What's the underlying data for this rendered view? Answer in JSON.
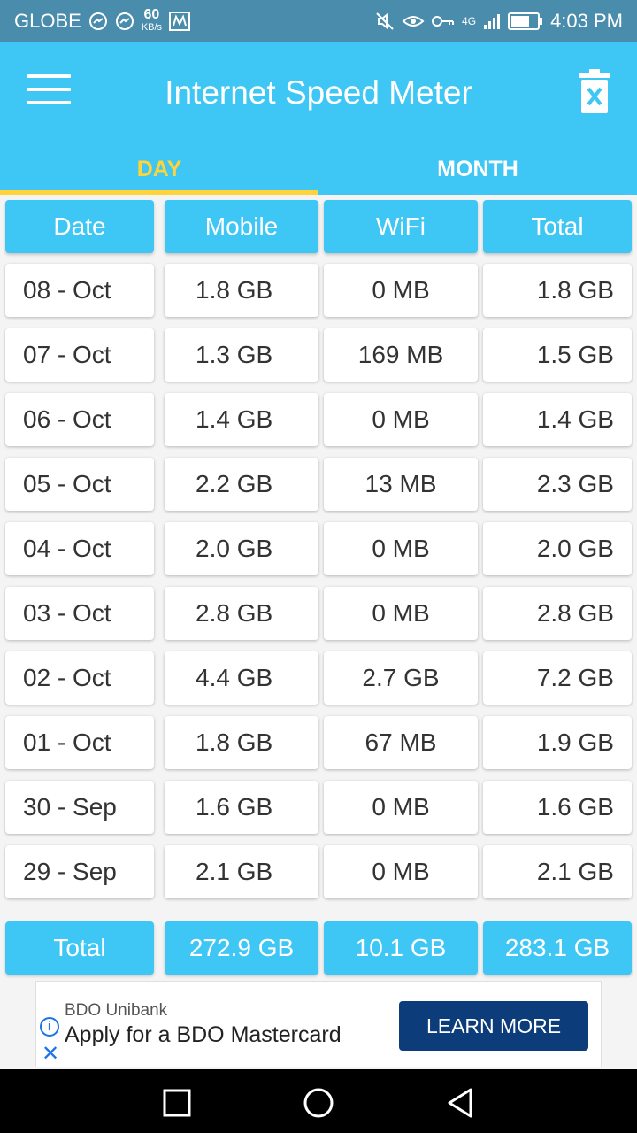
{
  "status_bar": {
    "carrier": "GLOBE",
    "speed_value": "60",
    "speed_unit": "KB/s",
    "network_label": "4G",
    "time": "4:03 PM"
  },
  "app_bar": {
    "title": "Internet Speed Meter",
    "accent_color": "#3ec6f4",
    "tab_active_color": "#ffd43a"
  },
  "tabs": [
    {
      "label": "DAY",
      "active": true
    },
    {
      "label": "MONTH",
      "active": false
    }
  ],
  "table": {
    "columns": [
      "Date",
      "Mobile",
      "WiFi",
      "Total"
    ],
    "rows": [
      [
        "08 - Oct",
        "1.8 GB",
        "0 MB",
        "1.8 GB"
      ],
      [
        "07 - Oct",
        "1.3 GB",
        "169 MB",
        "1.5 GB"
      ],
      [
        "06 - Oct",
        "1.4 GB",
        "0 MB",
        "1.4 GB"
      ],
      [
        "05 - Oct",
        "2.2 GB",
        "13 MB",
        "2.3 GB"
      ],
      [
        "04 - Oct",
        "2.0 GB",
        "0 MB",
        "2.0 GB"
      ],
      [
        "03 - Oct",
        "2.8 GB",
        "0 MB",
        "2.8 GB"
      ],
      [
        "02 - Oct",
        "4.4 GB",
        "2.7 GB",
        "7.2 GB"
      ],
      [
        "01 - Oct",
        "1.8 GB",
        "67 MB",
        "1.9 GB"
      ],
      [
        "30 - Sep",
        "1.6 GB",
        "0 MB",
        "1.6 GB"
      ],
      [
        "29 - Sep",
        "2.1 GB",
        "0 MB",
        "2.1 GB"
      ]
    ],
    "totals": [
      "Total",
      "272.9 GB",
      "10.1 GB",
      "283.1 GB"
    ]
  },
  "ad": {
    "brand": "BDO Unibank",
    "text": "Apply for a BDO Mastercard",
    "cta": "LEARN MORE",
    "info_icon": "i",
    "close_icon": "✕"
  }
}
